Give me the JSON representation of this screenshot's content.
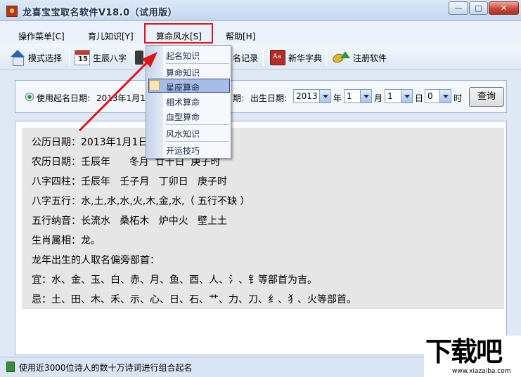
{
  "window": {
    "title": "龙喜宝宝取名软件V18.0（试用版）",
    "controls": {
      "minimize": "—",
      "maximize": "□",
      "close": "✕"
    }
  },
  "menubar": {
    "items": [
      {
        "label": "操作菜单[C]"
      },
      {
        "label": "育儿知识[Y]"
      },
      {
        "label": "算命风水[S]"
      },
      {
        "label": "帮助[H]"
      }
    ],
    "active": "算命风水[S]"
  },
  "toolbar": {
    "items": [
      {
        "label": "模式选择",
        "icon": "home-icon"
      },
      {
        "label": "生辰八字",
        "icon": "calendar-icon"
      },
      {
        "label": "名记录",
        "icon": "record-icon"
      },
      {
        "label": "新华字典",
        "icon": "dictionary-icon"
      },
      {
        "label": "注册软件",
        "icon": "key-icon"
      }
    ]
  },
  "dropdown": {
    "items": [
      {
        "label": "起名知识"
      },
      {
        "label": "算命知识"
      },
      {
        "label": "星座算命"
      },
      {
        "label": "相术算命"
      },
      {
        "label": "血型算命"
      },
      {
        "label": "风水知识"
      },
      {
        "label": "开运技巧"
      }
    ],
    "selected": "星座算命"
  },
  "datepanel": {
    "use_date_label": "使用起名日期:",
    "use_date_value": "2013年1月1日",
    "colon": "期:",
    "birth_label": "出生日期:",
    "year": "2013",
    "year_unit": "年",
    "month": "1",
    "month_unit": "月",
    "day": "1",
    "day_unit": "日",
    "hour": "0",
    "hour_unit": "时",
    "query_label": "查询"
  },
  "result": {
    "lines": [
      "公历日期：2013年1月1日0时",
      "农历日期：壬辰年      冬月  廿十日  庚子时",
      "八字四柱：壬辰年   壬子月   丁卯日   庚子时",
      "八字五行：水,土,水,水,火,木,金,水,（ 五行不缺 ）",
      "五行纳音：长流水   桑柘木   炉中火   壁上土",
      "生肖属相：龙。",
      "龙年出生的人取名偏旁部首：",
      "宜：水、金、玉、白、赤、月、鱼、酉、人、氵、钅等部首为吉。",
      "忌：土、田、木、禾、示、心、日、石、艹、力、刀、纟、犭、火等部首。"
    ]
  },
  "statusbar": {
    "text": "使用近3000位诗人的数十万诗词进行组合起名"
  },
  "watermark": {
    "text": "下载吧",
    "url": "www.xiazaiba.com"
  },
  "colors": {
    "highlight_box": "#e0141a",
    "arrow": "#e0141a",
    "menu_selection": "#a6bde5"
  }
}
